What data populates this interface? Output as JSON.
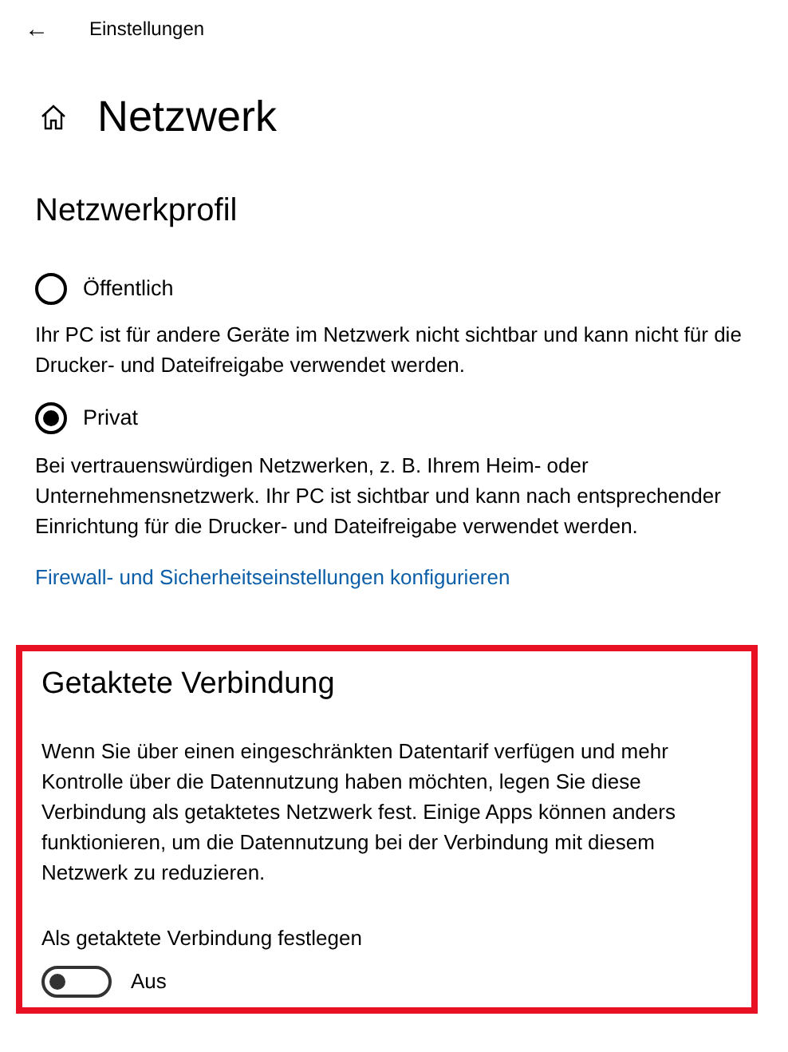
{
  "title_bar": {
    "back": "←",
    "title": "Einstellungen"
  },
  "page": {
    "heading": "Netzwerk"
  },
  "network_profile": {
    "heading": "Netzwerkprofil",
    "options": [
      {
        "label": "Öffentlich",
        "selected": false,
        "description": "Ihr PC ist für andere Geräte im Netzwerk nicht sichtbar und kann nicht für die Drucker- und Dateifreigabe verwendet werden."
      },
      {
        "label": "Privat",
        "selected": true,
        "description": "Bei vertrauenswürdigen Netzwerken, z. B. Ihrem Heim- oder Unternehmensnetzwerk. Ihr PC ist sichtbar und kann nach entsprechender Einrichtung für die Drucker- und Dateifreigabe verwendet werden."
      }
    ],
    "link": "Firewall- und Sicherheitseinstellungen konfigurieren"
  },
  "metered_connection": {
    "heading": "Getaktete Verbindung",
    "highlighted": true,
    "description": "Wenn Sie über einen eingeschränkten Datentarif verfügen und mehr Kontrolle über die Datennutzung haben möchten, legen Sie diese Verbindung als getaktetes Netzwerk fest. Einige Apps können anders funktionieren, um die Datennutzung bei der Verbindung mit diesem Netzwerk zu reduzieren.",
    "toggle_label": "Als getaktete Verbindung festlegen",
    "on": false,
    "state_text": "Aus"
  }
}
